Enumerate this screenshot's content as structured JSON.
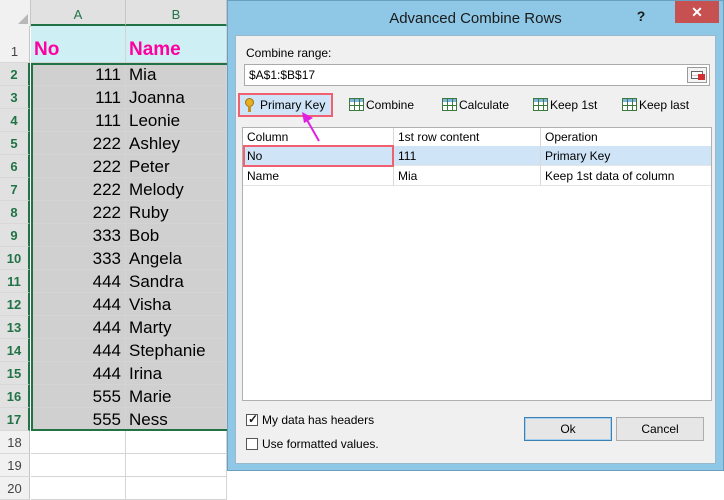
{
  "sheet": {
    "columns": [
      "A",
      "B"
    ],
    "row_numbers": [
      "1",
      "2",
      "3",
      "4",
      "5",
      "6",
      "7",
      "8",
      "9",
      "10",
      "11",
      "12",
      "13",
      "14",
      "15",
      "16",
      "17",
      "18",
      "19",
      "20"
    ],
    "header": {
      "a": "No",
      "b": "Name"
    },
    "rows": [
      {
        "a": "111",
        "b": "Mia"
      },
      {
        "a": "111",
        "b": "Joanna"
      },
      {
        "a": "111",
        "b": "Leonie"
      },
      {
        "a": "222",
        "b": "Ashley"
      },
      {
        "a": "222",
        "b": "Peter"
      },
      {
        "a": "222",
        "b": "Melody"
      },
      {
        "a": "222",
        "b": "Ruby"
      },
      {
        "a": "333",
        "b": "Bob"
      },
      {
        "a": "333",
        "b": "Angela"
      },
      {
        "a": "444",
        "b": "Sandra"
      },
      {
        "a": "444",
        "b": "Visha"
      },
      {
        "a": "444",
        "b": "Marty"
      },
      {
        "a": "444",
        "b": "Stephanie"
      },
      {
        "a": "444",
        "b": "Irina"
      },
      {
        "a": "555",
        "b": "Marie"
      },
      {
        "a": "555",
        "b": "Ness"
      }
    ],
    "colors": {
      "header_fill": "#cef0f4",
      "header_text": "#ff00a0",
      "data_fill": "#d0d0d0",
      "accent": "#217346"
    }
  },
  "dialog": {
    "title": "Advanced Combine Rows",
    "help": "?",
    "close": "✕",
    "range_label": "Combine range:",
    "range_value": "$A$1:$B$17",
    "toolbar": {
      "primary_key": "Primary Key",
      "combine": "Combine",
      "calculate": "Calculate",
      "keep_first": "Keep 1st",
      "keep_last": "Keep last"
    },
    "table": {
      "headers": [
        "Column",
        "1st row content",
        "Operation"
      ],
      "rows": [
        {
          "column": "No",
          "content": "111",
          "operation": "Primary Key"
        },
        {
          "column": "Name",
          "content": "Mia",
          "operation": "Keep 1st data of column"
        }
      ]
    },
    "options": {
      "has_headers": {
        "label": "My data has headers",
        "checked": true
      },
      "formatted_values": {
        "label": "Use formatted values.",
        "checked": false
      }
    },
    "buttons": {
      "ok": "Ok",
      "cancel": "Cancel"
    },
    "colors": {
      "frame": "#8ec8e6",
      "highlight": "#f06070",
      "arrow": "#e020e0",
      "selected_row": "#cfe4f7"
    }
  }
}
